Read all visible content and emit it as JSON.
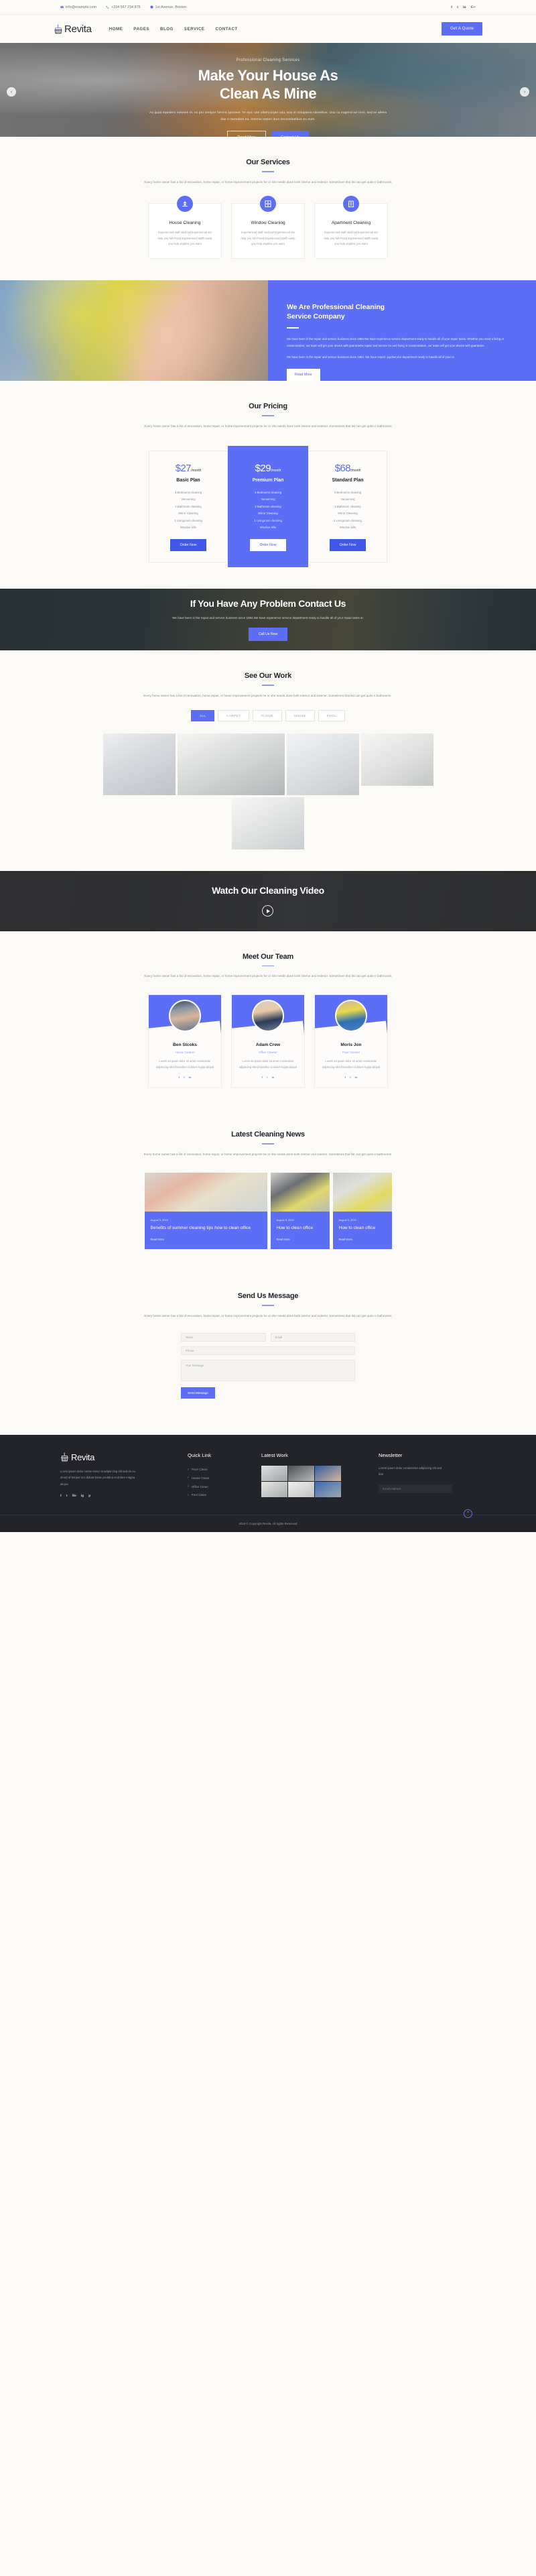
{
  "topbar": {
    "email": "info@example.com",
    "phone": "+234 567 234 875",
    "address": "1st Avenue, Boston",
    "social": [
      "f",
      "t",
      "in",
      "G+"
    ]
  },
  "nav": {
    "brand": "Revita",
    "menu": [
      "HOME",
      "PAGES",
      "BLOG",
      "SERVICE",
      "CONTACT"
    ],
    "cta": "Get A Quote"
  },
  "hero": {
    "kicker": "Professional Cleaning Services",
    "title_line1": "Make Your House As",
    "title_line2": "Clean As Mine",
    "subtitle": "As quas equidem nolusse et, ex pro semper fierent oporteat. Te epic utei ullamcorper usu, eos et voluptaria nitionibus. Usu cu eugend ad cinci, sed ex altera dae s ntumdam ea, inermis nation ibus necessitatibus eu eum.",
    "btn_primary": "Read More",
    "btn_secondary": "Contact Us",
    "arrow_prev": "‹",
    "arrow_next": "›"
  },
  "services": {
    "title": "Our Services",
    "desc": "Every home owner has a list of renovation, home repair, or home improvement projects he or she needs done both interior and exterior. Sometimes that list can get quite e bathrooms",
    "items": [
      {
        "icon": "house-cleaning-icon",
        "name": "House Cleaning",
        "text": "Experienced staff read nal Experienced sto help you full Prond Experienced staffr eaelp you help anytime you want"
      },
      {
        "icon": "window-cleaning-icon",
        "name": "Window Cleaning",
        "text": "Experienced staff read nal Experienced sto help you full Prond Experienced staffr eaelp you help anytime you want"
      },
      {
        "icon": "apartment-cleaning-icon",
        "name": "Apartment Cleaning",
        "text": "Experienced staff read nal Experienced sto help you full Prond Experienced staffr eaelp you help anytime you want"
      }
    ]
  },
  "about": {
    "title_line1": "We Are Professional Cleaning",
    "title_line2": "Service Company",
    "p1": "We have been in the repair and service business since 1984.We have experience service department ready to handle all of your repair tasks. Whether you need a fixing or customization, our team will get your device with guarantehe repair and service bu eed fixing or customization, our team will get your device with guarantee.",
    "p2": "We have been in the repair and service business since 1984. We have experi- jopdservice department ready to handle all of your re",
    "button": "Read More"
  },
  "pricing": {
    "title": "Our Pricing",
    "desc": "Every home owner has a list of renovation, home repair, or home improvement projects he or she needs done both interior and exterior. Sometimes that list can get quite e bathrooms",
    "plans": [
      {
        "amount": "$27",
        "per": "/month",
        "name": "Basic Plan",
        "features": [
          "3 Bedrooms cleaning",
          "Vacuuming",
          "2 Bathroom cleaning",
          "Mirror Cleaning",
          "1 Livingroom cleaning",
          "Window Sills"
        ],
        "button": "Order Now",
        "featured": false
      },
      {
        "amount": "$29",
        "per": "/month",
        "name": "Premium Plan",
        "features": [
          "3 Bedrooms cleaning",
          "Vacuuming",
          "2 Bathroom cleaning",
          "Mirror Cleaning",
          "1 Livingroom cleaning",
          "Window Sills"
        ],
        "button": "Order Now",
        "featured": true
      },
      {
        "amount": "$68",
        "per": "/month",
        "name": "Standard Plan",
        "features": [
          "3 Bedrooms cleaning",
          "Vacuuming",
          "2 Bathroom cleaning",
          "Mirror Cleaning",
          "1 Livingroom cleaning",
          "Window Sills"
        ],
        "button": "Order Now",
        "featured": false
      }
    ]
  },
  "cta": {
    "title": "If You Have Any Problem Contact Us",
    "desc": "We have been in the repair and service business since 1984.We have experience service department ready to handle all of your repair tasks in.",
    "button": "Call Us Now"
  },
  "portfolio": {
    "title": "See Our Work",
    "desc": "Every home owner has a list of renovation, home repair, or home improvement projects he or she needs done both interior and exterior. Sometimes that list can get quite e bathrooms .",
    "filters": [
      "ALL",
      "CARPET",
      "FLOOR",
      "HOUSE",
      "POOL"
    ],
    "active_filter": "ALL"
  },
  "video": {
    "title": "Watch Our Cleaning Video",
    "play": "play-button"
  },
  "team": {
    "title": "Meet Our Team",
    "desc": "Every home owner has a list of renovation, home repair, or home improvement projects he or she needs done both interior and exterior. Sometimes that list can get quite e bathrooms",
    "members": [
      {
        "name": "Ben Stcoks",
        "role": "House Cleaner",
        "bio": "Lorem as ipsum dolor sit amet consectetur adipiscing elited hasellus id dolore fugiat aliquid",
        "social": [
          "f",
          "t",
          "in"
        ]
      },
      {
        "name": "Adam Crew",
        "role": "Office Cleaner",
        "bio": "Lorem as ipsum dolor sit amet consectetur adipiscing elited hasellus id dolore fugiat aliquid",
        "social": [
          "f",
          "t",
          "in"
        ]
      },
      {
        "name": "Moris Jon",
        "role": "Floor Cleaner",
        "bio": "Lorem as ipsum dolor sit amet consectetur adipiscing elited hasellus id dolore fugiat aliquid",
        "social": [
          "f",
          "t",
          "in"
        ]
      }
    ]
  },
  "blog": {
    "title": "Latest Cleaning News",
    "desc": "Every home owner has a list of renovation, home repair, or home improvement projects he or she needs done both interior and exterior. Sometimes that list can get quite e bathrooms.",
    "posts": [
      {
        "date": "August 5, 2019",
        "title": "Benefits of summer cleaning tips how to clean office",
        "more": "Read More"
      },
      {
        "date": "August 5, 2019",
        "title": "How to clean office",
        "more": "Read More"
      },
      {
        "date": "August 5, 2019",
        "title": "How to clean office",
        "more": "Read More"
      }
    ]
  },
  "contact": {
    "title": "Send Us Message",
    "desc": "Every home owner has a list of renovation, home repair, or home improvement projects he or she needs done both interior and exterior. Sometimes that list can get quite e bathrooms",
    "name_placeholder": "Name",
    "email_placeholder": "Email",
    "phone_placeholder": "Phone",
    "message_placeholder": "Your Message",
    "submit": "Send Message"
  },
  "footer": {
    "brand": "Revita",
    "about": "Loren ipsum dolor conse ctetur at adipis cing elit sed do eu smod of tempor inci didunt know youlab a et dolore magna aliqua",
    "social": [
      "f",
      "t",
      "Be",
      "ig",
      "p"
    ],
    "quick_link_head": "Quick Link",
    "quick_links": [
      "Floor Clean",
      "House Clean",
      "Office Clean",
      "Pool Clean"
    ],
    "latest_work_head": "Latest Work",
    "newsletter_head": "Newsletter",
    "newsletter_text": "Lorem ipsum dolor consectetur adipiscing elit sed doe",
    "email_placeholder": "Email Address",
    "copyright": "2019 © Copyright Revita. All rights Reserved",
    "to_top": "^"
  }
}
